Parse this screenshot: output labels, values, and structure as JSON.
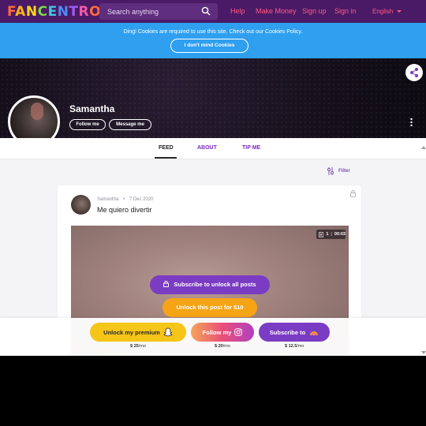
{
  "header": {
    "logo_letters": [
      "F",
      "A",
      "N",
      "C",
      "E",
      "N",
      "T",
      "R",
      "O"
    ],
    "search_placeholder": "Search anything",
    "nav": {
      "help": "Help",
      "make_money": "Make Money",
      "sign_up": "Sign up",
      "sign_in": "Sign in",
      "language": "English"
    }
  },
  "cookie_bar": {
    "message": "Ding! Cookies are required to use this site. Check out our Cookies Policy.",
    "button": "I don't mind Cookies"
  },
  "profile": {
    "name": "Samantha",
    "follow_button": "Follow me",
    "message_button": "Message me"
  },
  "tabs": {
    "feed": "FEED",
    "about": "ABOUT",
    "tip": "TIP ME"
  },
  "filter": {
    "label": "Filter"
  },
  "post": {
    "author": "Samantha",
    "separator": "•",
    "date": "7 Dec 2020",
    "title": "Me quiero divertir",
    "media_count": "1",
    "media_duration": "00:03",
    "subscribe_all": "Subscribe to unlock all posts",
    "unlock_post": "Unlock this post for $10"
  },
  "sticky_bar": {
    "premium_label": "Unlock my premium",
    "premium_price": "$ 25",
    "premium_period": "/mo",
    "follow_label": "Follow my",
    "follow_price": "$ 20",
    "follow_period": "/mo",
    "subscribe_label": "Subscribe to",
    "subscribe_price": "$ 12.5",
    "subscribe_period": "/mo"
  },
  "colors": {
    "nav_bg": "#4b1a66",
    "nav_link": "#ff5a87",
    "cookie_bg": "#2f9ff0",
    "accent_purple": "#7b3cc4",
    "accent_orange": "#f5a416",
    "accent_yellow": "#f5c518",
    "instagram_gradient": "#e94f7a"
  }
}
